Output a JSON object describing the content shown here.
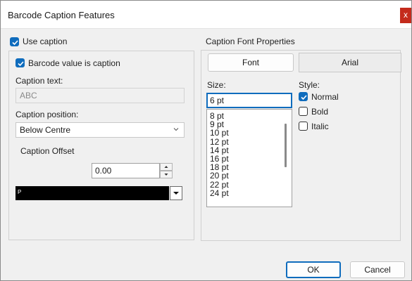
{
  "window": {
    "title": "Barcode Caption Features",
    "close_glyph": "x"
  },
  "caption": {
    "use_caption_label": "Use caption",
    "use_caption_checked": true,
    "barcode_value_label": "Barcode value is caption",
    "barcode_value_checked": true,
    "caption_text_label": "Caption text:",
    "caption_text_value": "ABC",
    "caption_position_label": "Caption position:",
    "caption_position_value": "Below Centre",
    "caption_offset_label": "Caption Offset",
    "caption_offset_value": "0.00",
    "color_label": "P"
  },
  "font": {
    "group_label": "Caption Font Properties",
    "font_button_label": "Font",
    "font_name": "Arial",
    "size_label": "Size:",
    "size_value": "6 pt",
    "size_options": [
      "8 pt",
      "9 pt",
      "10 pt",
      "12 pt",
      "14 pt",
      "16 pt",
      "18 pt",
      "20 pt",
      "22 pt",
      "24 pt"
    ],
    "style_label": "Style:",
    "style_normal": "Normal",
    "style_normal_checked": true,
    "style_bold": "Bold",
    "style_italic": "Italic"
  },
  "buttons": {
    "ok": "OK",
    "cancel": "Cancel"
  },
  "colors": {
    "accent": "#0f6cbd",
    "close": "#c42b1c"
  }
}
